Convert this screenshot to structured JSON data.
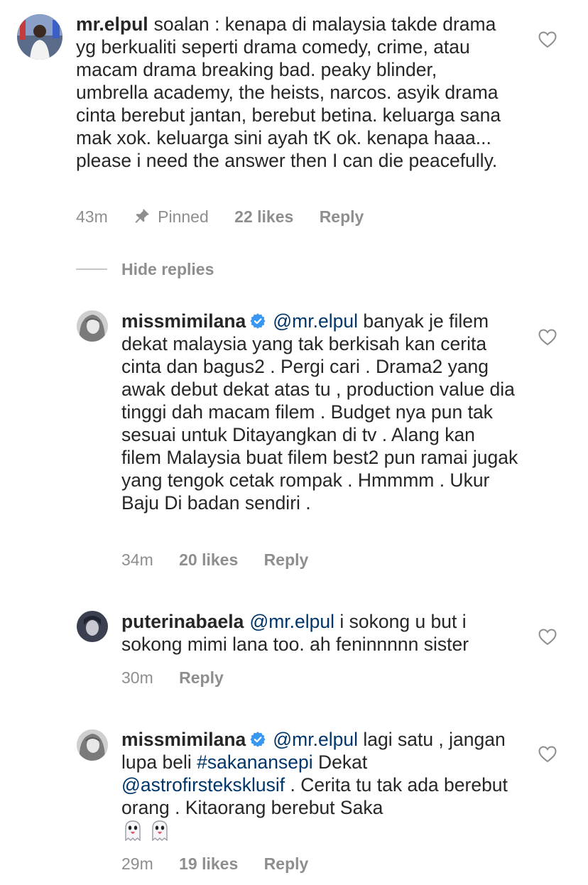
{
  "comments": [
    {
      "username": "mr.elpul",
      "text": "soalan : kenapa di malaysia takde drama yg berkualiti seperti drama comedy, crime, atau macam drama breaking bad. peaky blinder, umbrella academy, the heists, narcos. asyik drama cinta berebut jantan, berebut betina. keluarga sana mak xok. keluarga sini ayah tK ok. kenapa haaa... please i need the answer then I can die peacefully.",
      "time": "43m",
      "pinned_label": "Pinned",
      "likes": "22 likes",
      "reply_label": "Reply"
    }
  ],
  "hide_replies_label": "Hide replies",
  "replies": [
    {
      "username": "missmimilana",
      "mention": "@mr.elpul",
      "text": "banyak je filem dekat malaysia yang tak berkisah kan cerita cinta dan bagus2 . Pergi cari . Drama2 yang awak debut dekat atas tu , production value dia tinggi dah macam filem . Budget nya pun tak sesuai untuk Ditayangkan di tv . Alang kan filem Malaysia buat filem best2 pun ramai jugak yang tengok cetak rompak . Hmmmm . Ukur Baju Di badan sendiri .",
      "time": "34m",
      "likes": "20 likes",
      "reply_label": "Reply"
    },
    {
      "username": "puterinabaela",
      "mention": "@mr.elpul",
      "text": "i sokong u but i sokong mimi lana too. ah feninnnnn sister",
      "time": "30m",
      "reply_label": "Reply"
    },
    {
      "username": "missmimilana",
      "mention": "@mr.elpul",
      "text_part1": "lagi satu , jangan lupa beli",
      "hashtag": "#sakanansepi",
      "text_part2": "Dekat",
      "mention2": "@astrofirsteksklusif",
      "text_part3": ". Cerita tu tak ada berebut orang . Kitaorang berebut Saka",
      "time": "29m",
      "likes": "19 likes",
      "reply_label": "Reply"
    }
  ],
  "colors": {
    "text": "#262626",
    "meta": "#8e8e8e",
    "link": "#003569",
    "verified": "#3897f0"
  }
}
